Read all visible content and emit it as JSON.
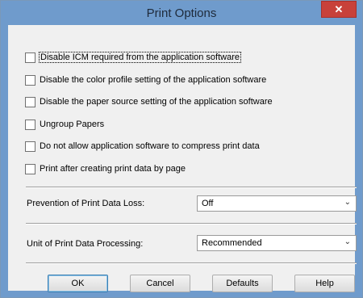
{
  "window": {
    "title": "Print Options",
    "close_glyph": "✕"
  },
  "checkboxes": [
    {
      "label": "Disable ICM required from the application software",
      "checked": false
    },
    {
      "label": "Disable the color profile setting of the application software",
      "checked": false
    },
    {
      "label": "Disable the paper source setting of the application software",
      "checked": false
    },
    {
      "label": "Ungroup Papers",
      "checked": false
    },
    {
      "label": "Do not allow application software to compress print data",
      "checked": false
    },
    {
      "label": "Print after creating print data by page",
      "checked": false
    }
  ],
  "fields": {
    "prevention": {
      "label": "Prevention of Print Data Loss:",
      "value": "Off"
    },
    "unit": {
      "label": "Unit of Print Data Processing:",
      "value": "Recommended"
    }
  },
  "buttons": {
    "ok": "OK",
    "cancel": "Cancel",
    "defaults": "Defaults",
    "help": "Help"
  },
  "icons": {
    "dropdown": "chevron-down-icon",
    "close": "close-icon"
  },
  "colors": {
    "titlebar": "#6f9bcc",
    "close": "#c8413a",
    "dialog": "#f0f0f0"
  }
}
